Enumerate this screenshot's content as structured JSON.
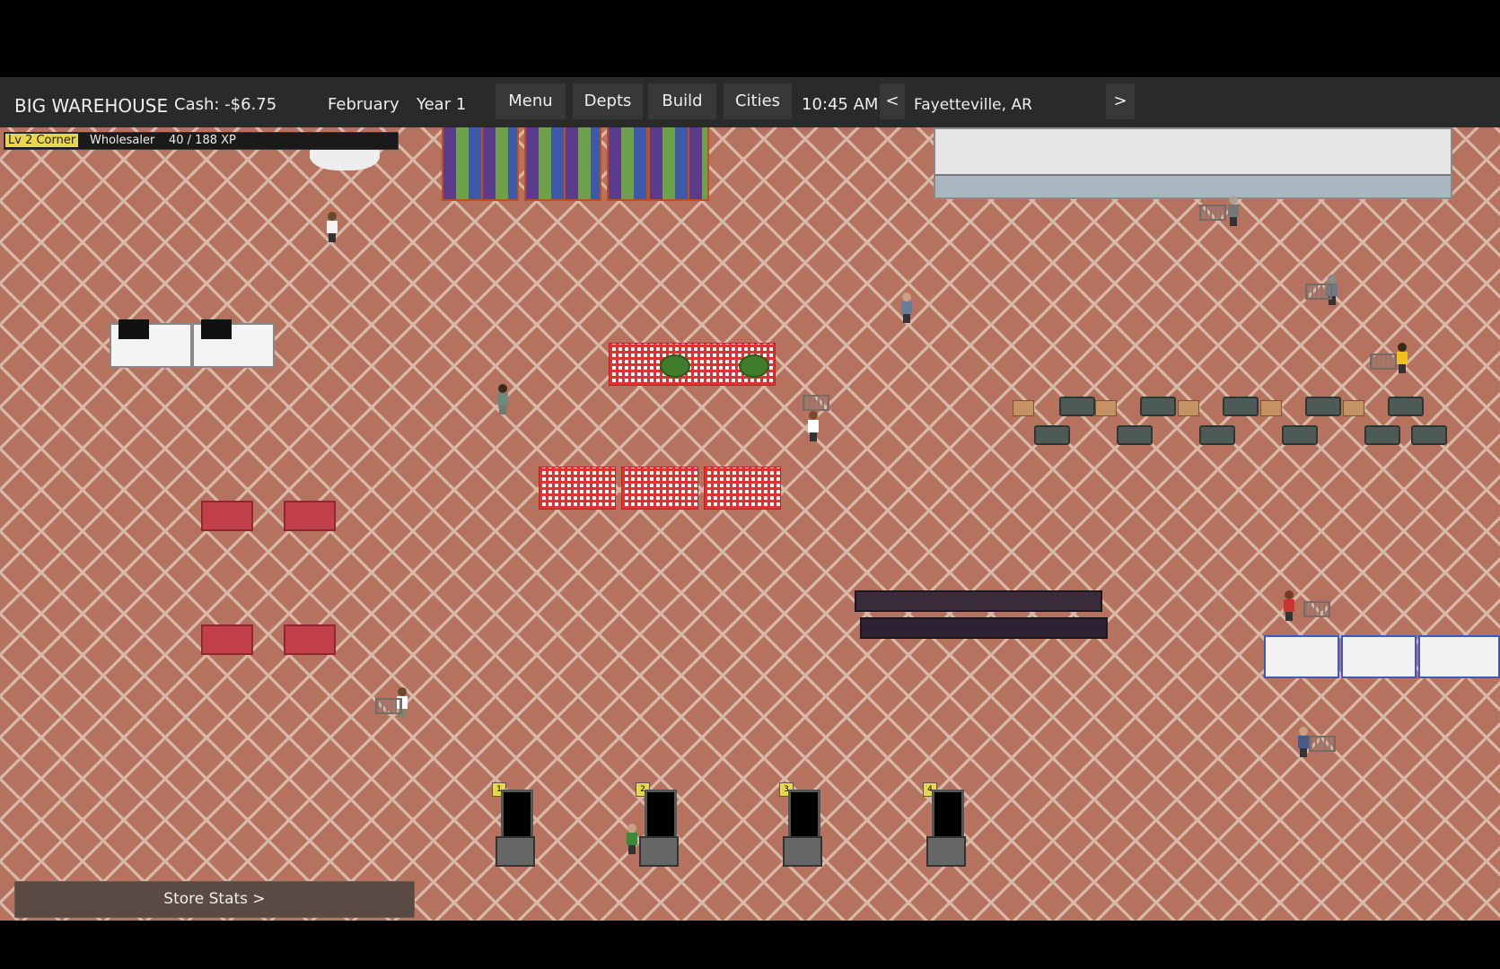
{
  "hud": {
    "store_name": "BIG WAREHOUSE",
    "cash": "Cash: -$6.75",
    "month": "February",
    "year": "Year 1",
    "time": "10:45 AM",
    "city": "Fayetteville, AR",
    "prev_city": "<",
    "next_city": ">",
    "menu_buttons": [
      "Menu",
      "Depts",
      "Build",
      "Cities"
    ]
  },
  "progress": {
    "level": "Lv 2",
    "rank": "Corner",
    "title": "Wholesaler",
    "xp": "40 / 188 XP",
    "xp_fraction": 0.21
  },
  "store_stats_button": "Store Stats  >",
  "kiosks": [
    "1",
    "2",
    "3",
    "4"
  ],
  "colors": {
    "floor": "#b5735f",
    "floor_grid": "#d9b9a7",
    "hud_bg": "#2a2a2a",
    "level_badge": "#e9d64a"
  }
}
